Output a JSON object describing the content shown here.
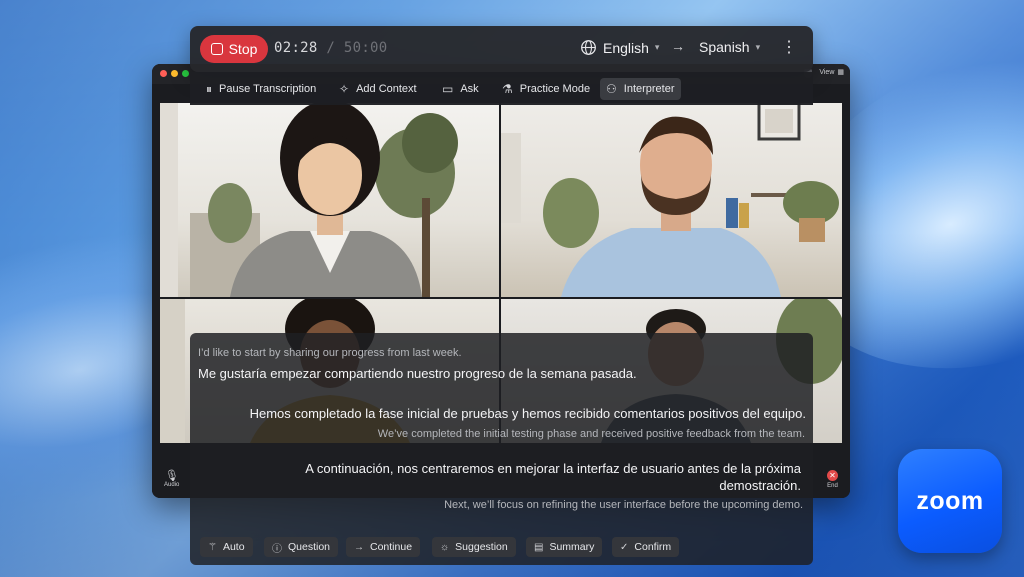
{
  "recording_bar": {
    "stop_label": "Stop",
    "elapsed": "02:28",
    "separator": "/",
    "total": "50:00",
    "source_language": "English",
    "target_language": "Spanish",
    "arrow": "→",
    "more": "⋮"
  },
  "toolbar": {
    "items": [
      {
        "label": "Pause Transcription",
        "icon": "pause-icon"
      },
      {
        "label": "Add Context",
        "icon": "sparkle-icon"
      },
      {
        "label": "Ask",
        "icon": "chat-icon"
      },
      {
        "label": "Practice Mode",
        "icon": "flask-icon"
      },
      {
        "label": "Interpreter",
        "icon": "interpreter-icon",
        "active": true
      }
    ]
  },
  "meeting_window": {
    "view_label": "View",
    "audio_label": "Audio",
    "end_label": "End"
  },
  "transcript": {
    "entries": [
      {
        "source": "I’d like to start by sharing our progress from last week.",
        "translation": "Me gustaría empezar compartiendo nuestro progreso de la semana pasada."
      },
      {
        "translation": "Hemos completado la fase inicial de pruebas y hemos recibido comentarios positivos del equipo.",
        "source": "We’ve completed the initial testing phase and received positive feedback from the team."
      },
      {
        "translation_line1": "A continuación, nos centraremos en mejorar la interfaz de usuario antes de la próxima",
        "translation_line2": "demostración.",
        "source": "Next, we’ll focus on refining the user interface before the upcoming demo."
      }
    ]
  },
  "actions": [
    {
      "label": "Auto",
      "icon": "magic-wand-icon"
    },
    {
      "label": "Question",
      "icon": "question-icon"
    },
    {
      "label": "Continue",
      "icon": "arrow-right-icon"
    },
    {
      "label": "Suggestion",
      "icon": "lightbulb-icon"
    },
    {
      "label": "Summary",
      "icon": "document-icon"
    },
    {
      "label": "Confirm",
      "icon": "check-icon"
    }
  ],
  "app_icon": {
    "label": "zoom"
  },
  "colors": {
    "stop_red": "#d9363e",
    "zoom_blue": "#0b5cff",
    "panel_bg": "#26282c"
  }
}
